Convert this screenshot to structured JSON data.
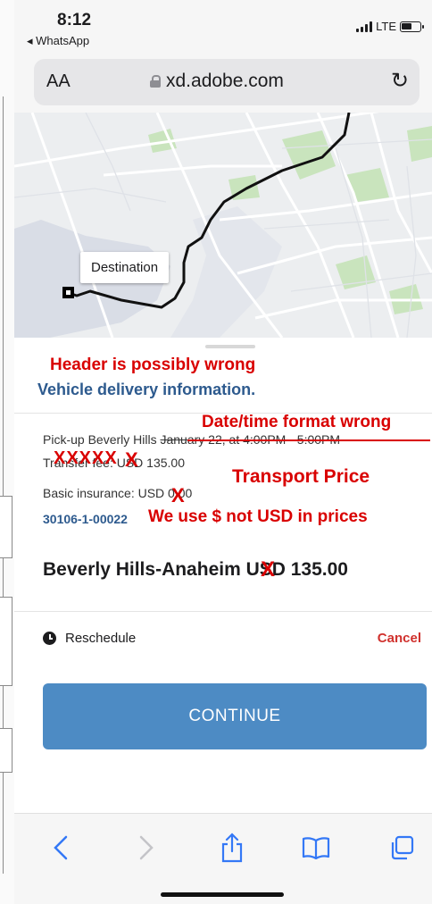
{
  "status_bar": {
    "time": "8:12",
    "back_app": "◂ WhatsApp",
    "network": "LTE"
  },
  "browser": {
    "text_size_button": "AA",
    "url": "xd.adobe.com",
    "reload_icon": "reload-icon"
  },
  "map": {
    "destination_label": "Destination"
  },
  "annotations": {
    "header": "Header is possibly wrong",
    "date_format": "Date/time format wrong",
    "crossed_out": "XXXXX",
    "transport_price": "Transport Price",
    "usd_note": "We use $ not USD in prices",
    "x_mark": "X",
    "color": "#d90000"
  },
  "sheet": {
    "title": "Vehicle delivery information.",
    "pickup_prefix": "Pick-up Beverly Hills ",
    "pickup_time": "January 22, at 4:00PM - 5:00PM",
    "transfer_fee": "Transfer fee: USD 135.00",
    "basic_insurance": "Basic insurance: USD 0.00",
    "reference": "30106-1-00022",
    "route_price": "Beverly Hills-Anaheim USD 135.00",
    "reschedule_label": "Reschedule",
    "cancel_label": "Cancel",
    "continue_label": "CONTINUE"
  },
  "toolbar": {
    "back": "back-icon",
    "forward": "forward-icon",
    "share": "share-icon",
    "bookmarks": "bookmarks-icon",
    "tabs": "tabs-icon"
  },
  "colors": {
    "accent_blue": "#4d8bc4",
    "title_blue": "#2d5a8e",
    "ios_blue": "#3478f6",
    "cancel_red": "#d0312d"
  }
}
